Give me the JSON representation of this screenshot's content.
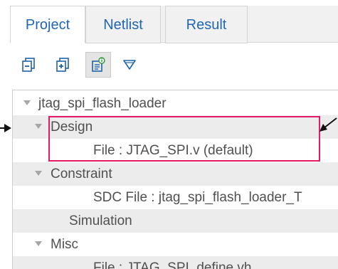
{
  "tabs": [
    {
      "label": "Project",
      "active": true
    },
    {
      "label": "Netlist",
      "active": false
    },
    {
      "label": "Result",
      "active": false
    }
  ],
  "toolbar": {
    "buttons": [
      {
        "icon": "collapse-all-icon",
        "active": false
      },
      {
        "icon": "expand-all-icon",
        "active": false
      },
      {
        "icon": "file-properties-icon",
        "active": true
      },
      {
        "icon": "filter-icon",
        "active": false
      }
    ]
  },
  "tree": {
    "rows": [
      {
        "label": "jtag_spi_flash_loader",
        "expanded": true
      },
      {
        "label": "Design",
        "expanded": true
      },
      {
        "label": "File : JTAG_SPI.v (default)"
      },
      {
        "label": "Constraint",
        "expanded": true
      },
      {
        "label": "SDC File : jtag_spi_flash_loader_T"
      },
      {
        "label": "Simulation"
      },
      {
        "label": "Misc",
        "expanded": true
      },
      {
        "label": "File : JTAG_SPI_define.vh"
      }
    ]
  },
  "colors": {
    "tab_text": "#1f66b3",
    "icon_blue": "#1e63ad",
    "highlight_border": "#e5196a",
    "row_alt": "#ececec",
    "tree_text": "#505050"
  }
}
